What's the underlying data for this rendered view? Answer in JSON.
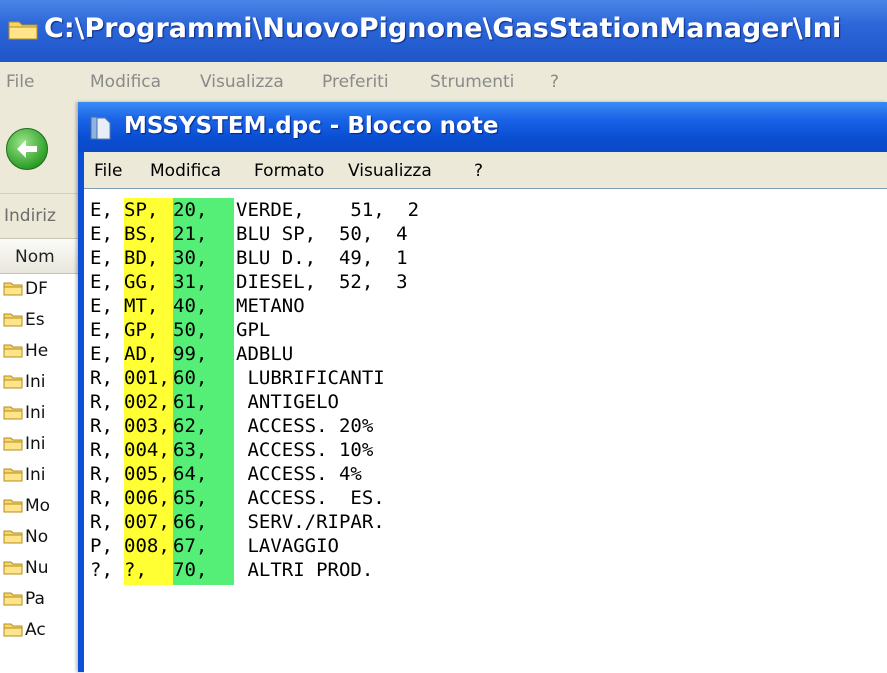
{
  "explorer": {
    "title": "C:\\Programmi\\NuovoPignone\\GasStationManager\\Ini",
    "menu": [
      "File",
      "Modifica",
      "Visualizza",
      "Preferiti",
      "Strumenti",
      "?"
    ],
    "address_label": "Indiriz",
    "column_header": "Nom",
    "items": [
      "DF",
      "Es",
      "He",
      "Ini",
      "Ini",
      "Ini",
      "Ini",
      "Mo",
      "No",
      "Nu",
      "Pa",
      "Ac"
    ]
  },
  "notepad": {
    "title": "MSSYSTEM.dpc - Blocco note",
    "menu": [
      "File",
      "Modifica",
      "Formato",
      "Visualizza",
      "?"
    ],
    "lines": [
      [
        "E,",
        "SP,",
        "20,",
        "VERDE,    51,  2"
      ],
      [
        "E,",
        "BS,",
        "21,",
        "BLU SP,  50,  4"
      ],
      [
        "E,",
        "BD,",
        "30,",
        "BLU D.,  49,  1"
      ],
      [
        "E,",
        "GG,",
        "31,",
        "DIESEL,  52,  3"
      ],
      [
        "E,",
        "MT,",
        "40,",
        "METANO"
      ],
      [
        "E,",
        "GP,",
        "50,",
        "GPL"
      ],
      [
        "E,",
        "AD,",
        "99,",
        "ADBLU"
      ],
      [
        "R,",
        "001,",
        "60,",
        " LUBRIFICANTI"
      ],
      [
        "R,",
        "002,",
        "61,",
        " ANTIGELO"
      ],
      [
        "R,",
        "003,",
        "62,",
        " ACCESS. 20%"
      ],
      [
        "R,",
        "004,",
        "63,",
        " ACCESS. 10%"
      ],
      [
        "R,",
        "005,",
        "64,",
        " ACCESS. 4%"
      ],
      [
        "R,",
        "006,",
        "65,",
        " ACCESS.  ES."
      ],
      [
        "R,",
        "007,",
        "66,",
        " SERV./RIPAR."
      ],
      [
        "P,",
        "008,",
        "67,",
        " LAVAGGIO"
      ],
      [
        "?,",
        "?,",
        "70,",
        " ALTRI PROD."
      ]
    ]
  }
}
